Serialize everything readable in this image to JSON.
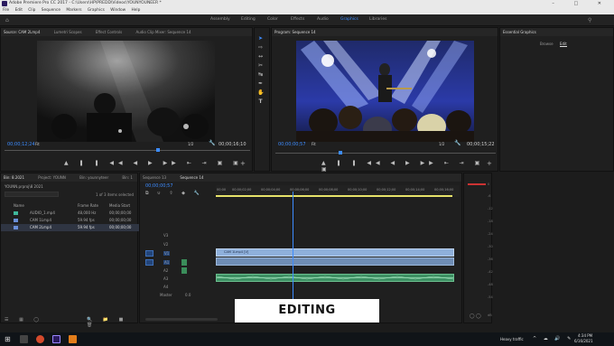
{
  "window": {
    "title": "Adobe Premiere Pro CC 2017 - C:\\Users\\HP\\PREDD\\Videos\\YOUNYOUNEER *"
  },
  "menu": [
    "File",
    "Edit",
    "Clip",
    "Sequence",
    "Markers",
    "Graphics",
    "Window",
    "Help"
  ],
  "workspaces": [
    {
      "label": "Assembly"
    },
    {
      "label": "Editing"
    },
    {
      "label": "Color"
    },
    {
      "label": "Effects"
    },
    {
      "label": "Audio"
    },
    {
      "label": "Graphics",
      "active": true
    },
    {
      "label": "Libraries"
    }
  ],
  "source_monitor": {
    "tabs": [
      "Source: CAM 2Lmp4",
      "Lumetri Scopes",
      "Effect Controls",
      "Audio Clip Mixer: Sequence 14"
    ],
    "timecode_in": "00;00;12;24",
    "fit": "Fit",
    "scale": "1/2",
    "timecode_out": "00;00;16;10"
  },
  "program_monitor": {
    "tab": "Program: Sequence 14",
    "timecode_in": "00;00;00;57",
    "fit": "Fit",
    "scale": "1/2",
    "timecode_out": "00;00;15;22"
  },
  "essential_graphics": {
    "title": "Essential Graphics",
    "tabs": [
      "Browse",
      "Edit"
    ],
    "active_tab": "Edit"
  },
  "project_panel": {
    "tabs": [
      "Bin: 8.2021",
      "Project: YOUNN",
      "Bin: younnyteer",
      "Bin: 1"
    ],
    "project_name": "YOUNN.prproj\\8 2021",
    "selection_info": "1 of 3 items selected",
    "columns": [
      "Name",
      "Frame Rate",
      "Media Start"
    ],
    "items": [
      {
        "name": "AUDIO_1.mp4",
        "rate": "48,000 Hz",
        "start": "00;00;00;00",
        "color": "#3fb79b"
      },
      {
        "name": "CAM 1Lmp4",
        "rate": "59.94 fps",
        "start": "00;00;00;00",
        "color": "#6a8fd8"
      },
      {
        "name": "CAM 2Lmp4",
        "rate": "59.94 fps",
        "start": "00;00;00;00",
        "color": "#6a8fd8"
      }
    ]
  },
  "timeline": {
    "tabs": [
      "Sequence 13",
      "Sequence 14"
    ],
    "active_tab": "Sequence 14",
    "timecode": "00;00;00;57",
    "ruler": [
      "00;00",
      "00;00;02;00",
      "00;00;04;00",
      "00;00;06;00",
      "00;00;08;00",
      "00;00;10;00",
      "00;00;12;00",
      "00;00;14;00",
      "00;00;16;00"
    ],
    "video_tracks": [
      "V3",
      "V2",
      "V1"
    ],
    "audio_tracks": [
      "A1",
      "A2",
      "A3",
      "A4"
    ],
    "master_label": "Master",
    "master_value": "0.0",
    "clips": {
      "v1": "CAM 1Lmp4 [V]",
      "a1": "",
      "a3": ""
    }
  },
  "meter_ticks": [
    "0",
    "-6",
    "-12",
    "-18",
    "-24",
    "-30",
    "-36",
    "-42",
    "-48",
    "-54",
    "dB"
  ],
  "overlay": {
    "caption": "EDITING"
  },
  "taskbar": {
    "weather": "Heavy traffic",
    "time": "4:34 PM",
    "date": "6/16/2021"
  },
  "colors": {
    "accent": "#3d8cff",
    "video_clip": "#8fb0db",
    "audio_clip": "#3d8f63"
  }
}
